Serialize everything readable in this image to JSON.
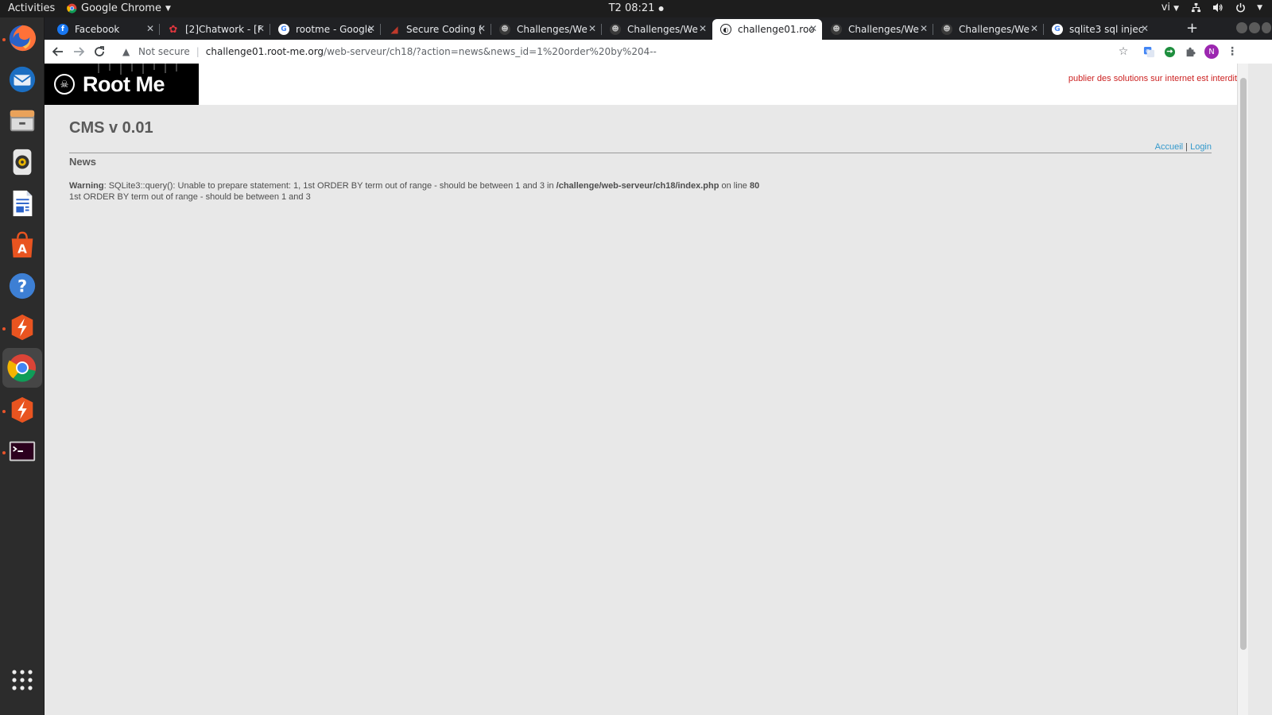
{
  "topbar": {
    "activities": "Activities",
    "app_name": "Google Chrome",
    "clock": "T2 08:21",
    "input_lang": "vi"
  },
  "dock": {
    "items": [
      "firefox-icon",
      "thunderbird-icon",
      "files-icon",
      "rhythmbox-icon",
      "writer-icon",
      "software-icon",
      "help-icon",
      "sublime-icon",
      "chrome-icon",
      "sublime-icon-2",
      "terminal-icon"
    ],
    "show_apps": "show-applications-icon"
  },
  "browser": {
    "tabs": [
      {
        "title": "Facebook",
        "icon": "facebook-icon"
      },
      {
        "title": "[2]Chatwork - [F",
        "icon": "chatwork-icon"
      },
      {
        "title": "rootme - Google",
        "icon": "google-icon"
      },
      {
        "title": "Secure Coding (",
        "icon": "securecoding-icon"
      },
      {
        "title": "Challenges/We",
        "icon": "rootme-icon"
      },
      {
        "title": "Challenges/We",
        "icon": "rootme-icon"
      },
      {
        "title": "challenge01.roo",
        "icon": "globe-icon",
        "active": true
      },
      {
        "title": "Challenges/We",
        "icon": "rootme-icon"
      },
      {
        "title": "Challenges/We",
        "icon": "rootme-icon"
      },
      {
        "title": "sqlite3 sql injec",
        "icon": "google-icon"
      }
    ],
    "security_label": "Not secure",
    "url_host": "challenge01.root-me.org",
    "url_path": "/web-serveur/ch18/?action=news&news_id=1%20order%20by%204--",
    "profile_initial": "N"
  },
  "page": {
    "logo_text": "Root Me",
    "banner": "publier des solutions sur internet est interdit",
    "title": "CMS v 0.01",
    "nav": {
      "home": "Accueil",
      "sep": "|",
      "login": "Login"
    },
    "section_heading": "News",
    "warning": {
      "label": "Warning",
      "message": ": SQLite3::query(): Unable to prepare statement: 1, 1st ORDER BY term out of range - should be between 1 and 3 in ",
      "file": "/challenge/web-serveur/ch18/index.php",
      "on_line": " on line ",
      "line": "80",
      "detail": "1st ORDER BY term out of range - should be between 1 and 3"
    }
  },
  "colors": {
    "banner_red": "#cc2222",
    "link_blue": "#3399cc",
    "page_bg": "#e8e8e8"
  }
}
